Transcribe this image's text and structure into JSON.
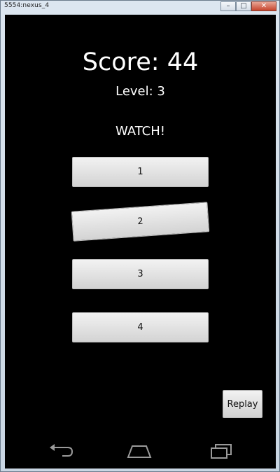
{
  "window": {
    "title": "5554:nexus_4",
    "minimize_label": "–",
    "maximize_label": "□",
    "close_label": "✕"
  },
  "game": {
    "score_label": "Score: 44",
    "level_label": "Level: 3",
    "status_label": "WATCH!",
    "buttons": [
      "1",
      "2",
      "3",
      "4"
    ],
    "replay_label": "Replay"
  },
  "navbar": {
    "icons": [
      "back-icon",
      "home-icon",
      "recent-apps-icon"
    ]
  }
}
